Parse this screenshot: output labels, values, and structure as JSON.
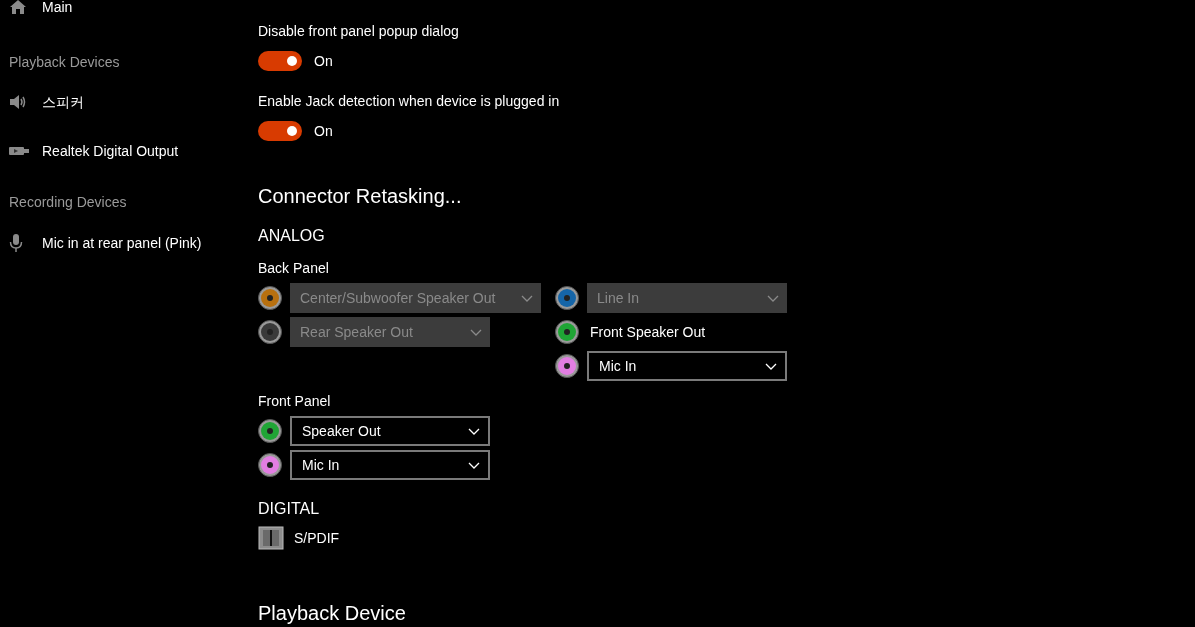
{
  "sidebar": {
    "items": [
      {
        "kind": "home",
        "label": "Main"
      },
      {
        "kind": "header",
        "label": "Playback Devices"
      },
      {
        "kind": "speaker",
        "label": "스피커"
      },
      {
        "kind": "digital-output",
        "label": "Realtek Digital Output"
      },
      {
        "kind": "header",
        "label": "Recording Devices"
      },
      {
        "kind": "mic",
        "label": "Mic in at rear panel (Pink)"
      }
    ]
  },
  "connector_settings": {
    "toggles": [
      {
        "label": "Disable front panel popup dialog",
        "on": true,
        "state_text": "On"
      },
      {
        "label": "Enable Jack detection when device is plugged in",
        "on": true,
        "state_text": "On"
      }
    ]
  },
  "connector_retasking": {
    "title": "Connector Retasking...",
    "analog": {
      "title": "ANALOG",
      "back_panel": {
        "title": "Back Panel",
        "columns": [
          [
            {
              "color": "#b8700f",
              "kind": "dropdown",
              "value": "Center/Subwoofer Speaker Out",
              "disabled": true
            },
            {
              "color": "#3a3a3a",
              "kind": "dropdown",
              "value": "Rear Speaker Out",
              "disabled": true
            }
          ],
          [
            {
              "color": "#1565a8",
              "kind": "dropdown",
              "value": "Line In",
              "disabled": true
            },
            {
              "color": "#1fa535",
              "kind": "label",
              "value": "Front Speaker Out"
            },
            {
              "color": "#e27ee2",
              "kind": "dropdown",
              "value": "Mic In",
              "disabled": false
            }
          ]
        ]
      },
      "front_panel": {
        "title": "Front Panel",
        "jacks": [
          {
            "color": "#1fa535",
            "kind": "dropdown",
            "value": "Speaker Out",
            "disabled": false
          },
          {
            "color": "#e27ee2",
            "kind": "dropdown",
            "value": "Mic In",
            "disabled": false
          }
        ]
      }
    },
    "digital": {
      "title": "DIGITAL",
      "items": [
        {
          "label": "S/PDIF"
        }
      ]
    }
  },
  "playback_device": {
    "title": "Playback Device"
  }
}
